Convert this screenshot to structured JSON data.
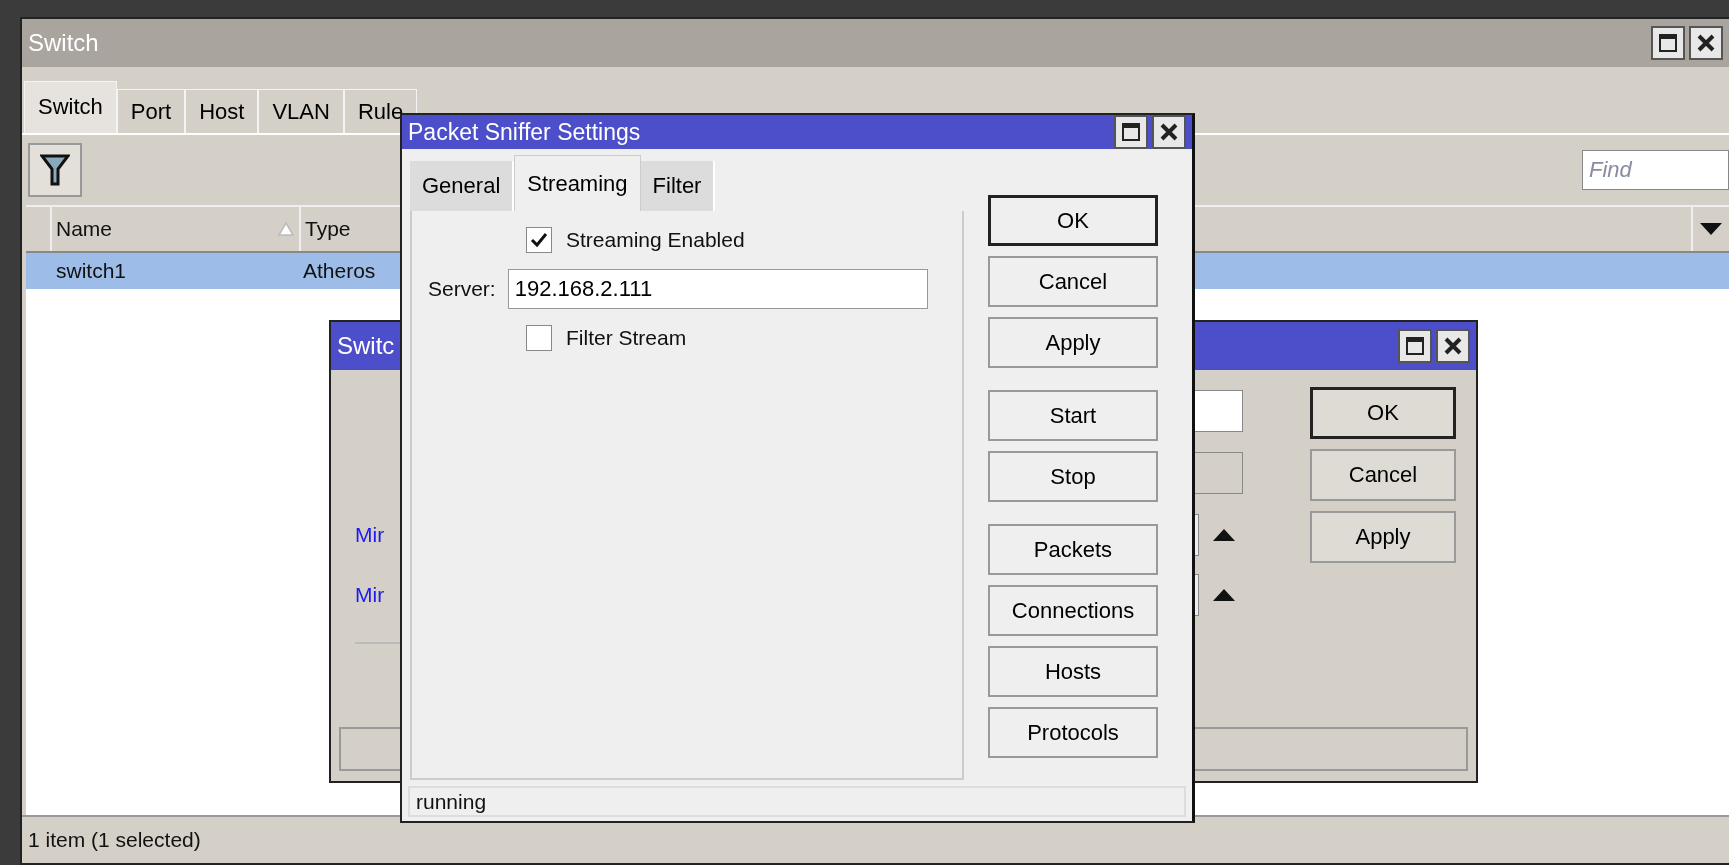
{
  "main_window": {
    "title": "Switch",
    "tabs": [
      {
        "label": "Switch",
        "selected": true
      },
      {
        "label": "Port",
        "selected": false
      },
      {
        "label": "Host",
        "selected": false
      },
      {
        "label": "VLAN",
        "selected": false
      },
      {
        "label": "Rule",
        "selected": false
      }
    ],
    "find": {
      "placeholder": "Find"
    },
    "table": {
      "columns": [
        "Name",
        "Type"
      ],
      "rows": [
        {
          "cells": [
            "switch1",
            "Atheros"
          ],
          "selected": true
        }
      ]
    },
    "status": "1 item (1 selected)"
  },
  "switch_dialog": {
    "title": "Switc",
    "labels": [
      "Mir",
      "Mir"
    ],
    "buttons": [
      {
        "label": "OK",
        "default": true
      },
      {
        "label": "Cancel",
        "default": false
      },
      {
        "label": "Apply",
        "default": false
      }
    ]
  },
  "sniffer": {
    "title": "Packet Sniffer Settings",
    "tabs": [
      {
        "label": "General",
        "selected": false
      },
      {
        "label": "Streaming",
        "selected": true
      },
      {
        "label": "Filter",
        "selected": false
      }
    ],
    "streaming_enabled": {
      "label": "Streaming Enabled",
      "checked": true
    },
    "server": {
      "label": "Server:",
      "value": "192.168.2.111"
    },
    "filter_stream": {
      "label": "Filter Stream",
      "checked": false
    },
    "button_groups": [
      [
        {
          "label": "OK",
          "default": true
        },
        {
          "label": "Cancel",
          "default": false
        },
        {
          "label": "Apply",
          "default": false
        }
      ],
      [
        {
          "label": "Start",
          "default": false
        },
        {
          "label": "Stop",
          "default": false
        }
      ],
      [
        {
          "label": "Packets",
          "default": false
        },
        {
          "label": "Connections",
          "default": false
        },
        {
          "label": "Hosts",
          "default": false
        },
        {
          "label": "Protocols",
          "default": false
        }
      ]
    ],
    "status": "running"
  }
}
